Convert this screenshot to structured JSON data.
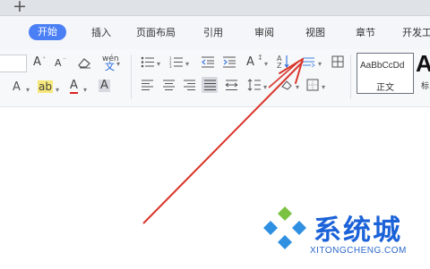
{
  "tabstrip": {
    "new_tab_symbol": "+"
  },
  "menu": {
    "items": [
      "开始",
      "插入",
      "页面布局",
      "引用",
      "审阅",
      "视图",
      "章节",
      "开发工"
    ],
    "active_index": 0
  },
  "ribbon": {
    "font_increase": "A",
    "font_decrease": "A",
    "phonetic": "wén",
    "phonetic_char": "文",
    "text_effect": "A",
    "highlight": "ab",
    "font_color": "A",
    "char_shading": "A",
    "text_direction": "A",
    "sort": "A↓",
    "style_sample": "AaBbCcDd",
    "style_name": "正文",
    "next_style_sample": "A",
    "next_style_name": "标"
  },
  "colors": {
    "accent": "#4a7ff6",
    "annotation": "#d9362b",
    "watermark_blue": "#1b62d8",
    "watermark_green": "#7cc242"
  },
  "watermark": {
    "title": "系统城",
    "url": "XITONGCHENG.COM"
  }
}
